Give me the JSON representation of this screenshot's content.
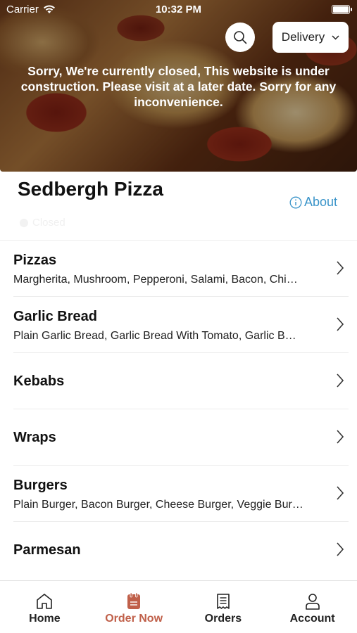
{
  "status_bar": {
    "carrier": "Carrier",
    "time": "10:32 PM"
  },
  "hero": {
    "delivery_label": "Delivery",
    "closed_message": "Sorry, We're currently closed, This website is under construction. Please visit at a later date. Sorry for any inconvenience."
  },
  "restaurant": {
    "name": "Sedbergh Pizza",
    "about_label": "About",
    "status_label": "Closed"
  },
  "menu": [
    {
      "title": "Pizzas",
      "desc": "Margherita, Mushroom, Pepperoni, Salami, Bacon, Chi…"
    },
    {
      "title": "Garlic Bread",
      "desc": "Plain Garlic Bread, Garlic Bread With Tomato, Garlic B…"
    },
    {
      "title": "Kebabs",
      "desc": ""
    },
    {
      "title": "Wraps",
      "desc": ""
    },
    {
      "title": "Burgers",
      "desc": "Plain Burger, Bacon Burger, Cheese Burger, Veggie Bur…"
    },
    {
      "title": "Parmesan",
      "desc": ""
    }
  ],
  "tabs": [
    {
      "label": "Home",
      "icon": "home-icon"
    },
    {
      "label": "Order Now",
      "icon": "order-bag-icon"
    },
    {
      "label": "Orders",
      "icon": "receipt-icon"
    },
    {
      "label": "Account",
      "icon": "user-icon"
    }
  ],
  "colors": {
    "accent": "#c0604a",
    "link": "#3a94c9"
  }
}
